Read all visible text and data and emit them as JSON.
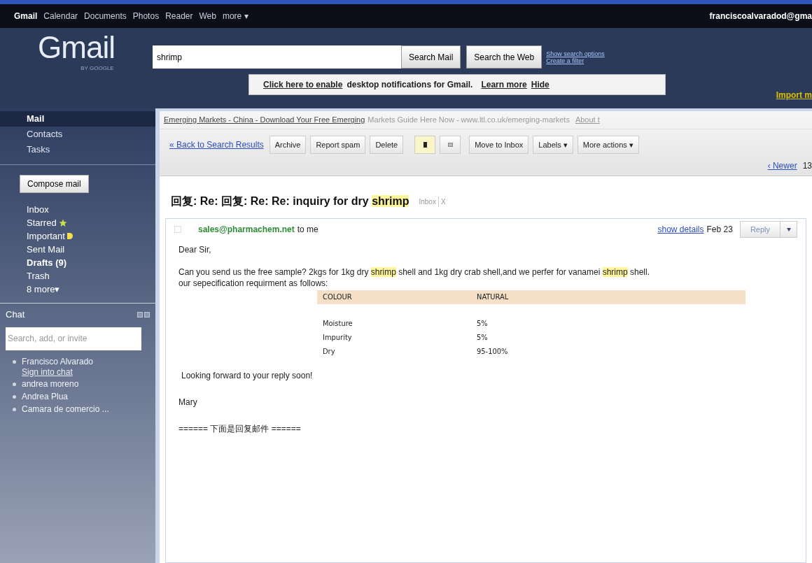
{
  "top_nav": {
    "links": [
      {
        "label": "Gmail",
        "selected": true
      },
      {
        "label": "Calendar",
        "selected": false
      },
      {
        "label": "Documents",
        "selected": false
      },
      {
        "label": "Photos",
        "selected": false
      },
      {
        "label": "Reader",
        "selected": false
      },
      {
        "label": "Web",
        "selected": false
      },
      {
        "label": "more ▾",
        "selected": false
      }
    ],
    "account": "franciscoalvaradod@gma"
  },
  "logo": {
    "text": "Gmail",
    "sub": "BY GOOGLE"
  },
  "search": {
    "value": "shrimp",
    "buttons": [
      "Search Mail",
      "Search the Web"
    ],
    "links": [
      "Show search options",
      "Create a filter"
    ]
  },
  "notification": {
    "link": "Click here to enable",
    "text": "desktop notifications for Gmail.",
    "actions": [
      "Learn more",
      "Hide"
    ]
  },
  "import_link": "Import m",
  "sidebar": {
    "apps": [
      {
        "label": "Mail",
        "selected": true
      },
      {
        "label": "Contacts",
        "selected": false
      },
      {
        "label": "Tasks",
        "selected": false
      }
    ],
    "compose": "Compose mail",
    "folders": [
      {
        "label": "Inbox",
        "kind": "plain",
        "unread": false
      },
      {
        "label": "Starred",
        "kind": "star",
        "unread": false
      },
      {
        "label": "Important",
        "kind": "marker",
        "unread": false
      },
      {
        "label": "Sent Mail",
        "kind": "plain",
        "unread": false
      },
      {
        "label": "Drafts (9)",
        "kind": "plain",
        "unread": true
      },
      {
        "label": "Trash",
        "kind": "plain",
        "unread": false
      },
      {
        "label": "8 more▾",
        "kind": "plain",
        "unread": false
      }
    ]
  },
  "chat": {
    "title": "Chat",
    "search_placeholder": "Search, add, or invite",
    "contacts": [
      {
        "name": "Francisco Alvarado",
        "link": "Sign into chat"
      },
      {
        "name": "andrea moreno"
      },
      {
        "name": "Andrea Plua"
      },
      {
        "name": "Camara de comercio ..."
      }
    ]
  },
  "ad": {
    "link": "Emerging Markets - China - Download Your Free Emerging",
    "text": "Markets Guide Here Now - www.ltl.co.uk/emerging-markets",
    "about": "About t"
  },
  "toolbar": {
    "back": "« Back to Search Results",
    "buttons": [
      {
        "kind": "text",
        "label": "Archive"
      },
      {
        "kind": "text",
        "label": "Report spam"
      },
      {
        "kind": "text",
        "label": "Delete"
      },
      {
        "kind": "marker-on"
      },
      {
        "kind": "marker-off"
      },
      {
        "kind": "text",
        "label": "Move to Inbox"
      },
      {
        "kind": "text",
        "label": "Labels ▾"
      },
      {
        "kind": "text",
        "label": "More actions ▾"
      }
    ]
  },
  "pager": {
    "newer": "‹ Newer",
    "count": "13"
  },
  "message": {
    "subject": [
      {
        "text": "回复: Re: 回复: Re: Re: inquiry for dry ",
        "highlight": false
      },
      {
        "text": "shrimp",
        "highlight": true
      }
    ],
    "labels": [
      {
        "text": "Inbox",
        "remove": "X"
      }
    ],
    "from": "sales@pharmachem.net",
    "to": "to me",
    "show_details": "show details",
    "date": "Feb 23",
    "reply": "Reply",
    "greeting": "Dear Sir,",
    "paragraph": [
      {
        "text": "Can you send us the free sample? 2kgs for 1kg dry ",
        "highlight": false
      },
      {
        "text": "shrimp",
        "highlight": true
      },
      {
        "text": " shell and 1kg dry crab shell,and we perfer for vanamei ",
        "highlight": false
      },
      {
        "text": "shrimp",
        "highlight": true
      },
      {
        "text": " shell.",
        "highlight": false
      }
    ],
    "spec_intro": "our sepecification requirment as follows:",
    "spec_rows": [
      {
        "kind": "header",
        "cells": [
          "COLOUR",
          "NATURAL"
        ]
      },
      {
        "kind": "data",
        "cells": [
          "Moisture",
          "5%"
        ]
      },
      {
        "kind": "data",
        "cells": [
          "Impurity",
          "5%"
        ]
      },
      {
        "kind": "data",
        "cells": [
          "Dry",
          "95-100%"
        ]
      }
    ],
    "closing": "Looking forward to your reply soon!",
    "signature": "Mary",
    "separator": "====== 下面是回复邮件 ======"
  }
}
